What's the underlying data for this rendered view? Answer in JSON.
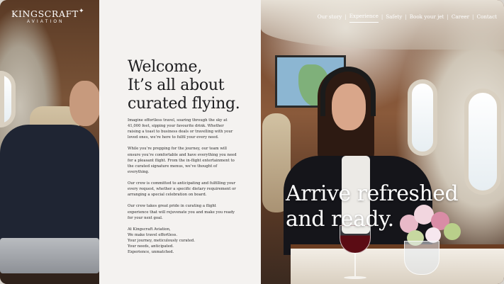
{
  "brand": {
    "name": "KINGSCRAFT",
    "sub": "AVIATION"
  },
  "nav": {
    "items": [
      {
        "label": "Our story",
        "active": false
      },
      {
        "label": "Experience",
        "active": true
      },
      {
        "label": "Safety",
        "active": false
      },
      {
        "label": "Book your jet",
        "active": false
      },
      {
        "label": "Career",
        "active": false
      },
      {
        "label": "Contact",
        "active": false
      }
    ],
    "separator": "|"
  },
  "hero": {
    "headline_lines": [
      "Welcome,",
      "It’s all about",
      "curated flying."
    ],
    "paragraphs": [
      "Imagine effortless travel, soaring through the sky at 41,000 feet, sipping your favourite drink. Whether raising a toast to business deals or travelling with your loved ones, we’re here to fulfil your every need.",
      "While you’re prepping for the journey, our team will ensure you’re comfortable and have everything you need for a pleasant flight. From the in-flight entertainment to the curated signature menus, we’ve thought of everything.",
      "Our crew is committed to anticipating and fulfilling your every request, whether a specific dietary requirement or arranging a special celebration on board.",
      "Our crew takes great pride in curating a flight experience that will rejuvenate you and make you ready for your next goal."
    ],
    "signoff_lines": [
      "At Kingscraft Aviation,",
      "We make travel effortless.",
      "Your journey, meticulously curated.",
      "Your needs, anticipated.",
      "Experience, unmatched."
    ]
  },
  "tagline_lines": [
    "Arrive refreshed",
    "and ready."
  ],
  "colors": {
    "text_dark": "#1d1d1f",
    "nav_text": "#ffffff",
    "panel_bg": "#ffffff"
  }
}
